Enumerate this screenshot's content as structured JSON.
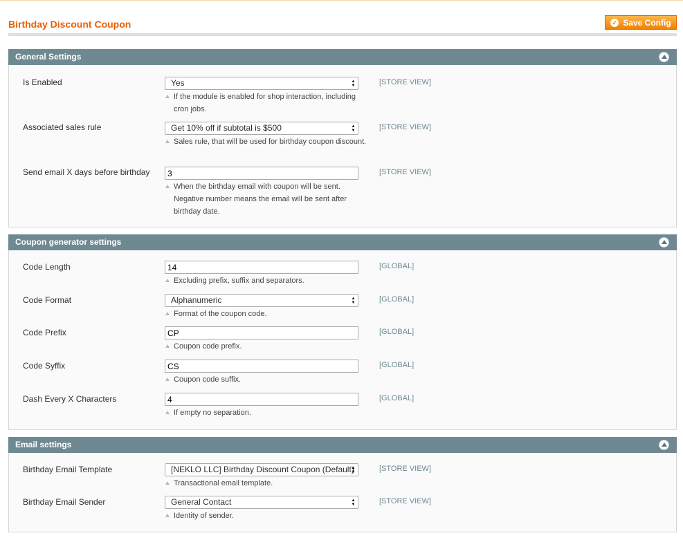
{
  "page": {
    "title": "Birthday Discount Coupon",
    "save_label": "Save Config"
  },
  "sections": [
    {
      "title": "General Settings",
      "rows": [
        {
          "label": "Is Enabled",
          "value": "Yes",
          "note": "If the module is enabled for shop interaction, including cron jobs.",
          "scope": "[STORE VIEW]"
        },
        {
          "label": "Associated sales rule",
          "value": "Get 10% off if subtotal is $500",
          "note": "Sales rule, that will be used for birthday coupon discount.",
          "scope": "[STORE VIEW]"
        },
        {
          "label": "Send email X days before birthday",
          "value": "3",
          "note": "When the birthday email with coupon will be sent. Negative number means the email will be sent after birthday date.",
          "scope": "[STORE VIEW]"
        }
      ]
    },
    {
      "title": "Coupon generator settings",
      "rows": [
        {
          "label": "Code Length",
          "value": "14",
          "note": "Excluding prefix, suffix and separators.",
          "scope": "[GLOBAL]"
        },
        {
          "label": "Code Format",
          "value": "Alphanumeric",
          "note": "Format of the coupon code.",
          "scope": "[GLOBAL]"
        },
        {
          "label": "Code Prefix",
          "value": "CP",
          "note": "Coupon code prefix.",
          "scope": "[GLOBAL]"
        },
        {
          "label": "Code Syffix",
          "value": "CS",
          "note": "Coupon code suffix.",
          "scope": "[GLOBAL]"
        },
        {
          "label": "Dash Every X Characters",
          "value": "4",
          "note": "If empty no separation.",
          "scope": "[GLOBAL]"
        }
      ]
    },
    {
      "title": "Email settings",
      "rows": [
        {
          "label": "Birthday Email Template",
          "value": "[NEKLO LLC] Birthday Discount Coupon (Default)",
          "note": "Transactional email template.",
          "scope": "[STORE VIEW]"
        },
        {
          "label": "Birthday Email Sender",
          "value": "General Contact",
          "note": "Identity of sender.",
          "scope": "[STORE VIEW]"
        }
      ]
    }
  ],
  "icons": {
    "save": "check-circle-icon",
    "collapse": "collapse-up-icon",
    "select_arrow": "updown-arrows-icon",
    "note": "note-arrow-icon"
  },
  "colors": {
    "accent": "#eb5e00",
    "button": "#f18200",
    "section_header": "#6f8992",
    "scope_text": "#6f8992"
  }
}
